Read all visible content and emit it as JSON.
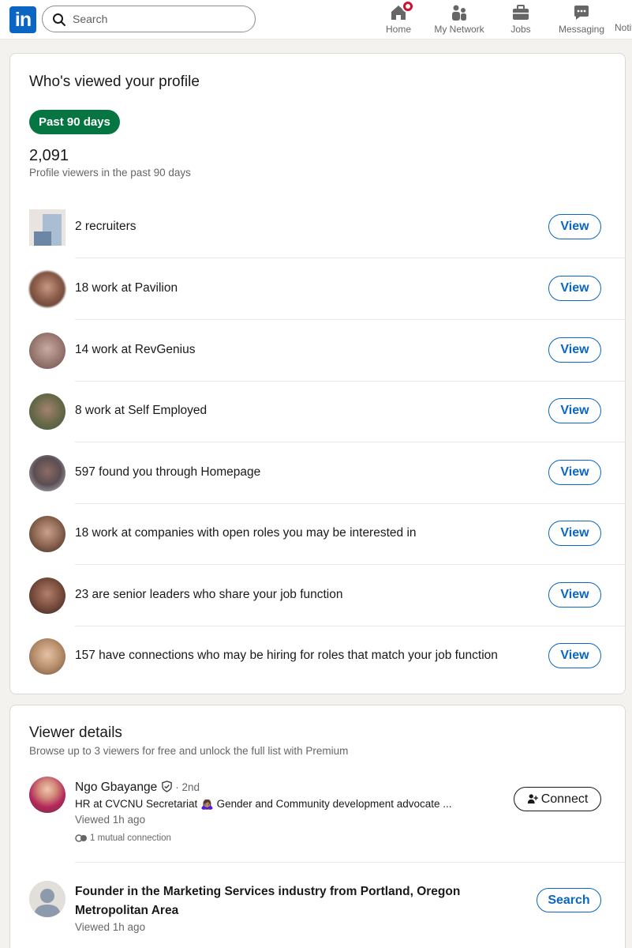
{
  "nav": {
    "logo": "in",
    "search_placeholder": "Search",
    "items": [
      {
        "label": "Home",
        "icon": "home-icon"
      },
      {
        "label": "My Network",
        "icon": "network-icon"
      },
      {
        "label": "Jobs",
        "icon": "briefcase-icon"
      },
      {
        "label": "Messaging",
        "icon": "messaging-icon"
      },
      {
        "label": "Notif",
        "icon": "bell-icon"
      }
    ]
  },
  "profile_views": {
    "title": "Who's viewed your profile",
    "filter_pill": "Past 90 days",
    "count": "2,091",
    "count_caption": "Profile viewers in the past 90 days",
    "rows": [
      {
        "label": "2 recruiters",
        "button": "View"
      },
      {
        "label": "18 work at  Pavilion",
        "button": "View"
      },
      {
        "label": "14 work at  RevGenius",
        "button": "View"
      },
      {
        "label": "8 work at  Self Employed",
        "button": "View"
      },
      {
        "label": "597 found you through Homepage",
        "button": "View"
      },
      {
        "label": "18 work at companies with open roles you may be interested in",
        "button": "View"
      },
      {
        "label": "23 are senior leaders who share your job function",
        "button": "View"
      },
      {
        "label": "157 have connections who may be hiring for roles that match your job function",
        "button": "View"
      }
    ]
  },
  "viewer_details": {
    "title": "Viewer details",
    "subtitle": "Browse up to 3 viewers for free and unlock the full list with Premium",
    "viewers": [
      {
        "name": "Ngo Gbayange",
        "degree": "· 2nd",
        "headline": "HR at CVCNU Secretariat 🙇🏽‍♀️ Gender and Community development advocate ...",
        "time": "Viewed 1h ago",
        "mutual": "1 mutual connection",
        "button": "Connect"
      },
      {
        "title": "Founder in the Marketing Services industry from Portland, Oregon Metropolitan Area",
        "time": "Viewed 1h ago",
        "button": "Search"
      }
    ]
  },
  "colors": {
    "brand": "#0a66c2",
    "pill_green": "#057642",
    "notification_red": "#cb112d",
    "background": "#f4f2ee"
  }
}
